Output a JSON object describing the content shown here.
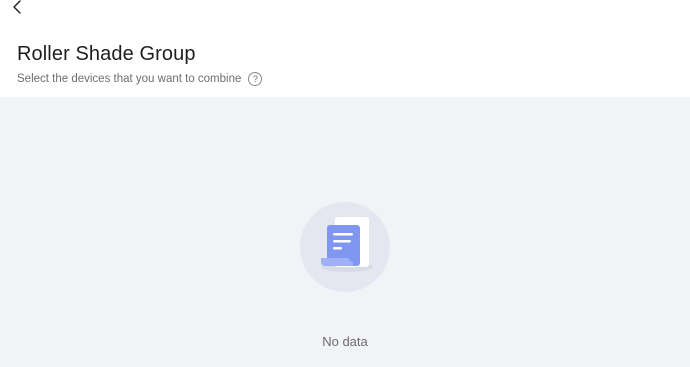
{
  "header": {
    "back_icon": "chevron-left-icon",
    "title": "Roller Shade Group",
    "subtitle": "Select the devices that you want to combine",
    "help_icon": "question-circle-icon",
    "help_glyph": "?"
  },
  "content": {
    "empty_icon": "document-empty-icon",
    "empty_text": "No data"
  },
  "colors": {
    "background": "#f2f3f7",
    "illustration_blue": "#7f97f0"
  }
}
